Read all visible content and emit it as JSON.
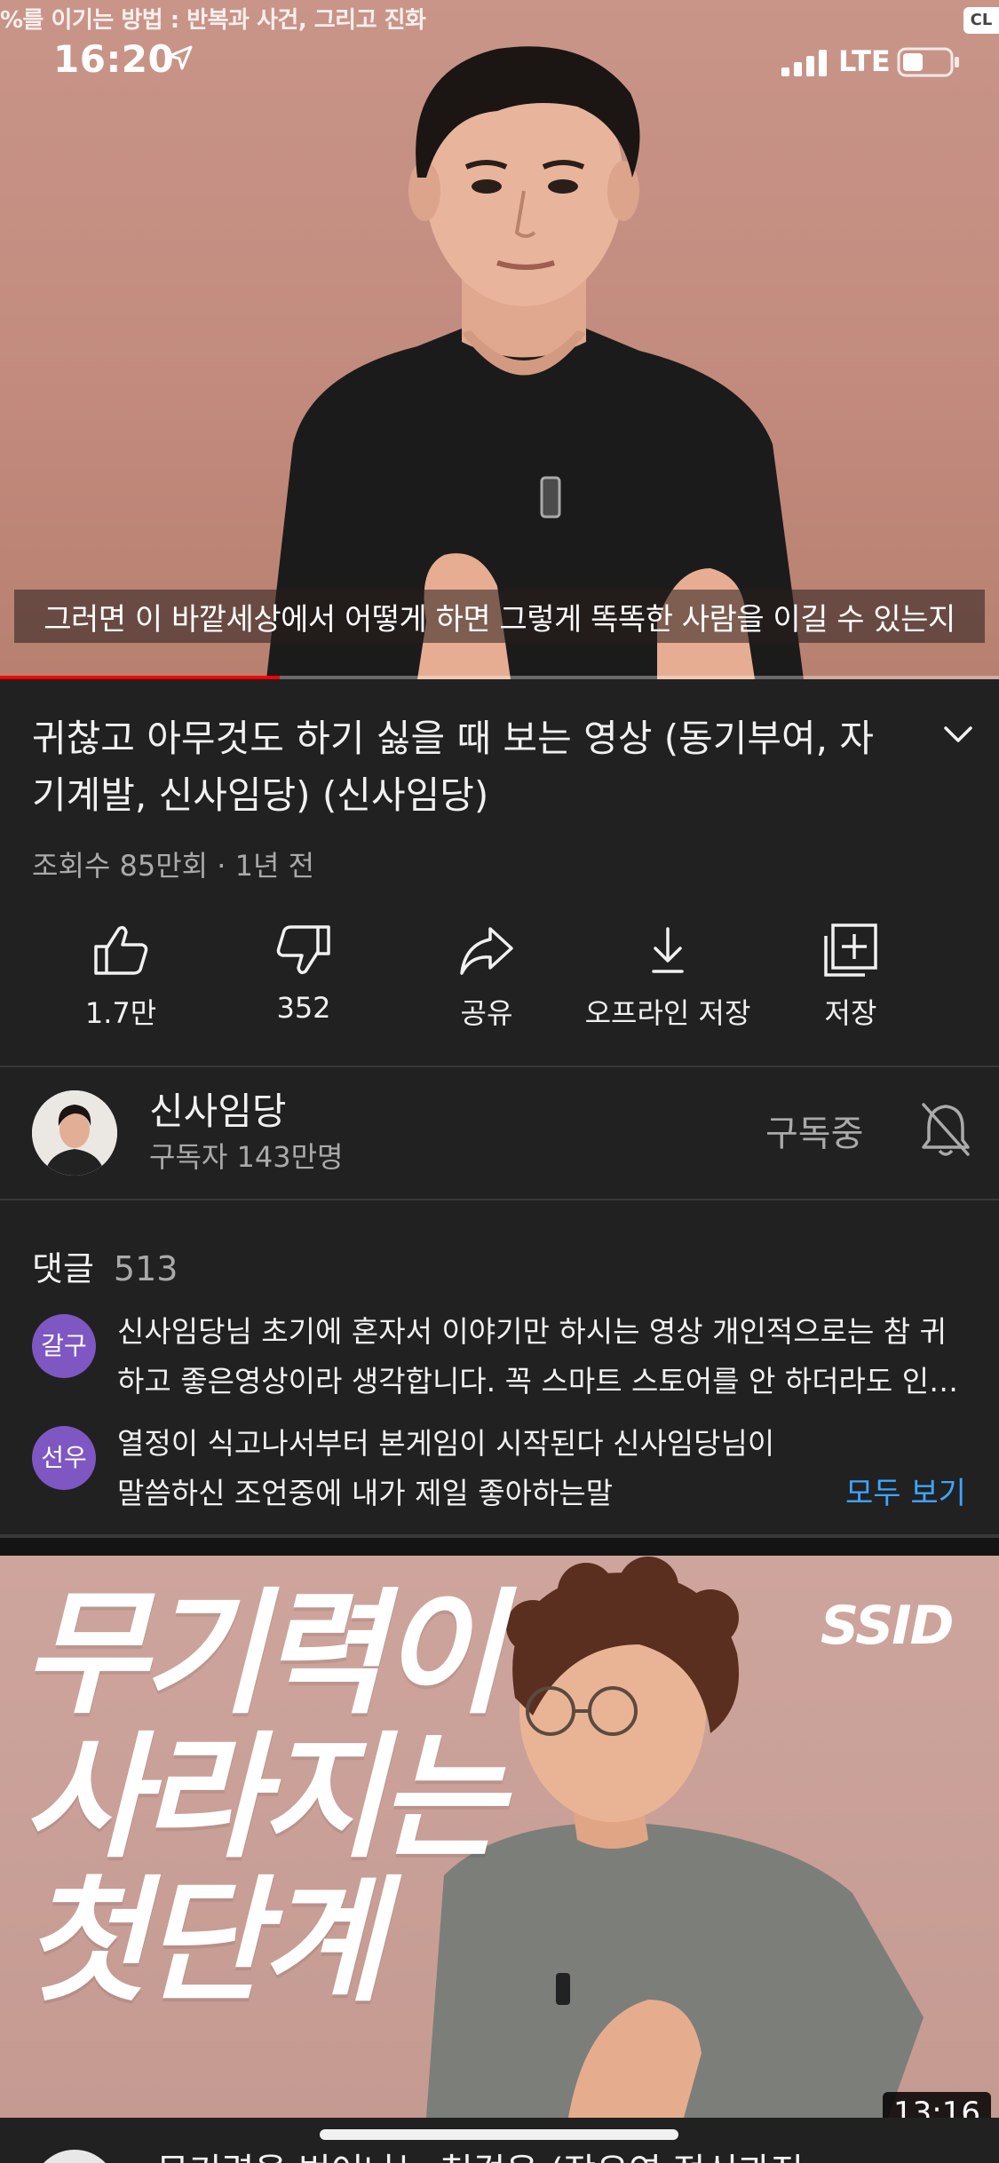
{
  "status_bar": {
    "time": "16:20",
    "network": "LTE"
  },
  "player": {
    "top_caption": "%를 이기는 방법 : 반복과 사건, 그리고 진화",
    "corner_badge": "CL",
    "subtitle": "그러면 이 바깥세상에서 어떻게 하면 그렇게 똑똑한 사람을 이길 수 있는지",
    "progress": 0.28
  },
  "video": {
    "title": "귀찮고 아무것도 하기 싫을 때 보는 영상 (동기부여, 자기계발, 신사임당)  (신사임당)",
    "meta": "조회수 85만회 · 1년 전"
  },
  "actions": [
    {
      "label": "1.7만",
      "icon": "thumbs-up-icon"
    },
    {
      "label": "352",
      "icon": "thumbs-down-icon"
    },
    {
      "label": "공유",
      "icon": "share-icon"
    },
    {
      "label": "오프라인 저장",
      "icon": "download-icon"
    },
    {
      "label": "저장",
      "icon": "add-to-playlist-icon"
    }
  ],
  "channel": {
    "name": "신사임당",
    "subscribers": "구독자 143만명",
    "subscribe_label": "구독중"
  },
  "comments": {
    "header": "댓글",
    "count": "513",
    "items": [
      {
        "avatar_text": "갈구",
        "line1": "신사임당님 초기에 혼자서 이야기만 하시는 영상 개인적으로는 참 귀",
        "line2": "하고 좋은영상이라 생각합니다. 꼭 스마트 스토어를 안 하더라도 인…"
      },
      {
        "avatar_text": "선우",
        "line1": "열정이 식고나서부터 본게임이 시작된다 신사임당님이",
        "line2": "말씀하신 조언중에 내가 제일 좋아하는말"
      }
    ],
    "show_all": "모두 보기"
  },
  "next_video": {
    "thumbnail_headline": "무기력이\n사라지는\n첫단계",
    "thumbnail_logo": "SSID",
    "duration": "13:16",
    "title": "무기력을 벗어나는 첫걸음 (장유연 정신과전"
  },
  "colors": {
    "background": "#212121",
    "progress": "#ff0000",
    "link": "#3ea6ff",
    "secondary_text": "#aaaaaa",
    "avatar_purple": "#7e57c2"
  }
}
